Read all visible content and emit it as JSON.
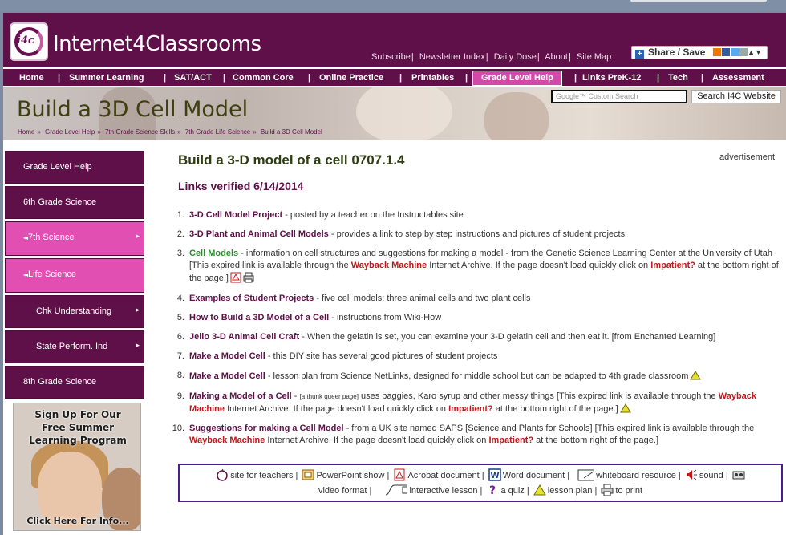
{
  "site": {
    "logo_text": "i4c",
    "brand": "Internet4Classrooms"
  },
  "toplinks": [
    "Subscribe",
    "Newsletter Index",
    "Daily Dose",
    "About",
    "Site Map"
  ],
  "share": {
    "label": "Share / Save"
  },
  "nav": [
    {
      "label": "Home"
    },
    {
      "label": "Summer Learning"
    },
    {
      "label": "SAT/ACT"
    },
    {
      "label": "Common Core"
    },
    {
      "label": "Online Practice"
    },
    {
      "label": "Printables"
    },
    {
      "label": "Grade Level Help"
    },
    {
      "label": "Links PreK-12"
    },
    {
      "label": "Tech"
    },
    {
      "label": "Assessment"
    }
  ],
  "banner": {
    "title": "Build a 3D Cell Model",
    "search_placeholder": "Google™ Custom Search",
    "search_button": "Search I4C Website",
    "breadcrumbs": [
      "Home",
      "Grade Level Help",
      "7th Grade Science Skills",
      "7th Grade Life Science",
      "Build a 3D Cell Model"
    ]
  },
  "sidebar": [
    {
      "label": "Grade Level Help"
    },
    {
      "label": "6th Grade Science"
    },
    {
      "label": "7th Science"
    },
    {
      "label": "Life Science"
    },
    {
      "label": "Chk Understanding"
    },
    {
      "label": "State Perform. Ind"
    },
    {
      "label": "8th Grade Science"
    }
  ],
  "promo": {
    "line1": "Sign Up For Our",
    "line2": "Free Summer",
    "line3": "Learning Program",
    "cta": "Click Here For Info..."
  },
  "main": {
    "title": "Build a 3-D model of a cell 0707.1.4",
    "advertisement": "advertisement",
    "verified": "Links verified 6/14/2014",
    "wayback": "Wayback Machine",
    "impatient": "Impatient?",
    "items": [
      {
        "num": "1.",
        "link": "3-D Cell Model Project",
        "text": " - posted by a teacher on the Instructables site"
      },
      {
        "num": "2.",
        "link": "3-D Plant and Animal Cell Models",
        "text": " - provides a link to step by step instructions and pictures of student projects"
      },
      {
        "num": "3.",
        "link": "Cell Models",
        "text": " - information on cell structures and suggestions for making a model - from the Genetic Science Learning Center at the University of Utah [This expired link is available through the ",
        "text_b": " Internet Archive. If the page doesn't load quickly click on ",
        "text_c": " at the bottom right of the page.]"
      },
      {
        "num": "4.",
        "link": "Examples of Student Projects",
        "text": " - five cell models: three animal cells and two plant cells"
      },
      {
        "num": "5.",
        "link": "How to Build a 3D Model of a Cell",
        "text": " - instructions from Wiki-How"
      },
      {
        "num": "6.",
        "link": "Jello 3-D Animal Cell Craft",
        "text": " - When the gelatin is set, you can examine your 3-D gelatin cell and then eat it. [from Enchanted Learning]"
      },
      {
        "num": "7.",
        "link": "Make a Model Cell",
        "text": " - this DIY site has several good pictures of student projects"
      },
      {
        "num": "8.",
        "link": "Make a Model Cell",
        "text": " - lesson plan from Science NetLinks, designed for middle school but can be adapted to 4th grade classroom"
      },
      {
        "num": "9.",
        "link": "Making a Model of a Cell",
        "small": "[a thunk queer page]",
        "text": " - ",
        "text_a": " uses baggies, Karo syrup and other messy things [This expired link is available through the ",
        "text_b": " Internet Archive. If the page doesn't load quickly click on ",
        "text_c": " at the bottom right of the page.]"
      },
      {
        "num": "10.",
        "link": "Suggestions for making a Cell Model",
        "text": " - from a UK site named SAPS [Science and Plants for Schools] [This expired link is available through the ",
        "text_b": " Internet Archive. If the page doesn't load quickly click on ",
        "text_c": " at the bottom right of the page.]"
      }
    ]
  },
  "legend": [
    {
      "icon": "apple-icon",
      "label": "site for teachers"
    },
    {
      "icon": "powerpoint-icon",
      "label": "PowerPoint show"
    },
    {
      "icon": "acrobat-icon",
      "label": "Acrobat document"
    },
    {
      "icon": "word-icon",
      "label": "Word document"
    },
    {
      "icon": "whiteboard-icon",
      "label": "whiteboard resource"
    },
    {
      "icon": "sound-icon",
      "label": "sound"
    },
    {
      "icon": "video-icon",
      "label": "video format"
    },
    {
      "icon": "interactive-icon",
      "label": "interactive lesson"
    },
    {
      "icon": "quiz-icon",
      "label": "a quiz"
    },
    {
      "icon": "lesson-plan-icon",
      "label": "lesson plan"
    },
    {
      "icon": "print-icon",
      "label": "to print"
    }
  ],
  "colors": {
    "brand": "#5f1048",
    "accent": "#d149a9",
    "link_red": "#c0181b"
  }
}
